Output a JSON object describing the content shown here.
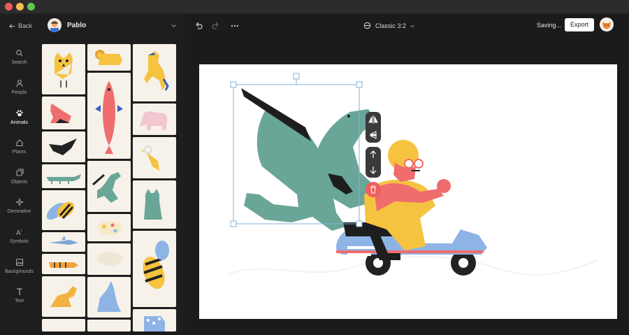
{
  "window": {
    "controls": [
      "close",
      "minimize",
      "maximize"
    ]
  },
  "sidebar": {
    "back_label": "Back",
    "items": [
      {
        "label": "Search",
        "icon": "search-icon"
      },
      {
        "label": "People",
        "icon": "person-icon"
      },
      {
        "label": "Animals",
        "icon": "paw-icon",
        "active": true
      },
      {
        "label": "Plants",
        "icon": "plant-icon"
      },
      {
        "label": "Objects",
        "icon": "objects-icon"
      },
      {
        "label": "Decorative",
        "icon": "sparkle-icon"
      },
      {
        "label": "Symbols",
        "icon": "symbols-icon"
      },
      {
        "label": "Backgrounds",
        "icon": "image-icon"
      },
      {
        "label": "Text",
        "icon": "text-icon"
      }
    ]
  },
  "panel": {
    "user_name": "Pablo",
    "items": [
      "owl",
      "lion",
      "horse",
      "fox",
      "fish",
      "elephant",
      "crow",
      "bird",
      "crocodile",
      "dragon",
      "bee",
      "cat",
      "shark",
      "pig",
      "bee",
      "tiger",
      "sheep",
      "dog",
      "wolf",
      "zebra"
    ]
  },
  "toolbar": {
    "format_label": "Classic 3:2",
    "saving_label": "Saving...",
    "export_label": "Export"
  },
  "canvas": {
    "selected_item": "dragon",
    "colors": {
      "dragon": "#6aa697",
      "selection": "#7fb3d8",
      "scooter": "#f26d6d",
      "jacket": "#f5c340",
      "helmet": "#f5c340",
      "scooter_body": "#8eb4e6"
    }
  },
  "float_toolbar": {
    "items": [
      "flip-horizontal-icon",
      "flip-vertical-icon",
      "bring-forward-icon",
      "send-backward-icon",
      "delete-icon"
    ]
  }
}
